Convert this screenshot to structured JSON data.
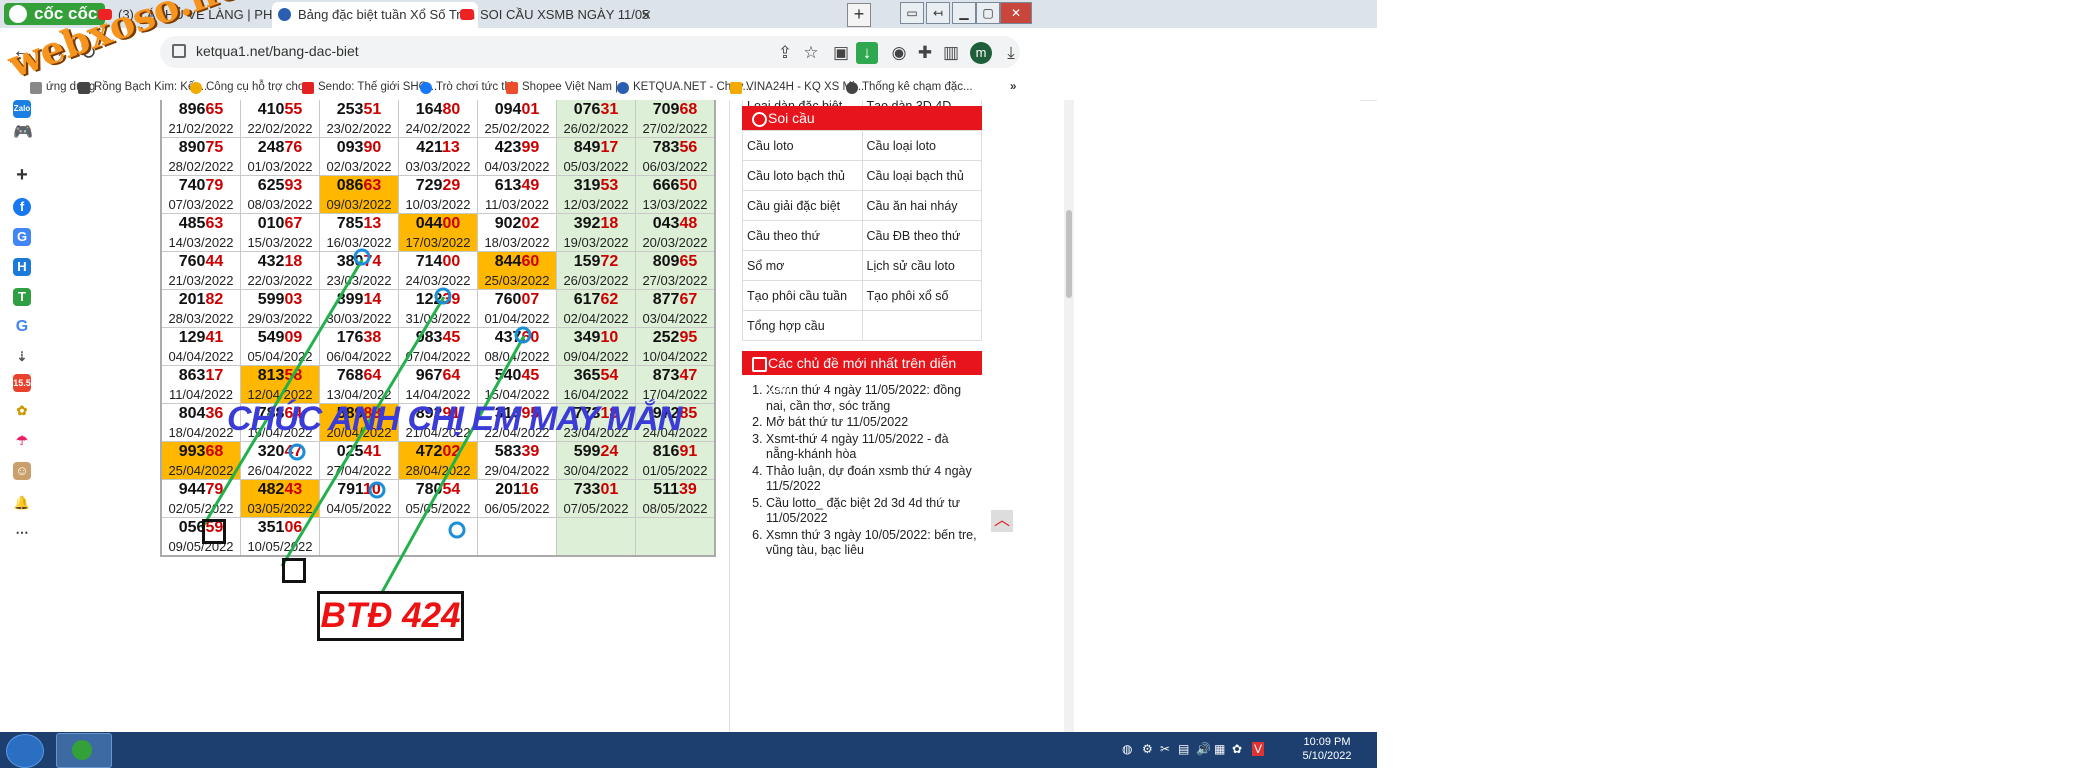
{
  "browser": {
    "brand": "cốc cốc",
    "tabs": [
      {
        "title": "(3) CÁCHỦ VỀ LÀNG | PHIM",
        "icon": "youtube-icon"
      },
      {
        "title": "Bảng đặc biệt tuần Xổ Số Trun",
        "icon": "ketqua-icon",
        "active": true
      },
      {
        "title": "SOI CẦU XSMB NGÀY 11/05",
        "icon": "youtube-icon"
      }
    ],
    "url": "ketqua1.net/bang-dac-biet",
    "profile_initial": "m",
    "bookmarks": [
      "ứng dụng",
      "Rồng Bạch Kim: Kết...",
      "Công cụ hỗ trợ cho...",
      "Sendo: Thế giới SHO...",
      "Trò chơi tức thì",
      "Shopee Việt Nam |...",
      "KETQUA.NET - Chuy...",
      "VINA24H - KQ XS Mi...",
      "Thống kê chạm đặc..."
    ],
    "overflow": "»"
  },
  "watermark": "webxoso.net",
  "grid": {
    "rows": [
      [
        {
          "n": "89665",
          "d": "21/02/2022"
        },
        {
          "n": "41055",
          "d": "22/02/2022"
        },
        {
          "n": "25351",
          "d": "23/02/2022"
        },
        {
          "n": "16480",
          "d": "24/02/2022"
        },
        {
          "n": "09401",
          "d": "25/02/2022"
        },
        {
          "n": "07631",
          "d": "26/02/2022"
        },
        {
          "n": "70968",
          "d": "27/02/2022"
        }
      ],
      [
        {
          "n": "89075",
          "d": "28/02/2022"
        },
        {
          "n": "24876",
          "d": "01/03/2022"
        },
        {
          "n": "09390",
          "d": "02/03/2022"
        },
        {
          "n": "42113",
          "d": "03/03/2022"
        },
        {
          "n": "42399",
          "d": "04/03/2022"
        },
        {
          "n": "84917",
          "d": "05/03/2022"
        },
        {
          "n": "78356",
          "d": "06/03/2022"
        }
      ],
      [
        {
          "n": "74079",
          "d": "07/03/2022"
        },
        {
          "n": "62593",
          "d": "08/03/2022"
        },
        {
          "n": "08663",
          "d": "09/03/2022",
          "hl": true
        },
        {
          "n": "72929",
          "d": "10/03/2022"
        },
        {
          "n": "61349",
          "d": "11/03/2022"
        },
        {
          "n": "31953",
          "d": "12/03/2022"
        },
        {
          "n": "66650",
          "d": "13/03/2022"
        }
      ],
      [
        {
          "n": "48563",
          "d": "14/03/2022"
        },
        {
          "n": "01067",
          "d": "15/03/2022"
        },
        {
          "n": "78513",
          "d": "16/03/2022"
        },
        {
          "n": "04400",
          "d": "17/03/2022",
          "hl": true
        },
        {
          "n": "90202",
          "d": "18/03/2022"
        },
        {
          "n": "39218",
          "d": "19/03/2022"
        },
        {
          "n": "04348",
          "d": "20/03/2022"
        }
      ],
      [
        {
          "n": "76044",
          "d": "21/03/2022"
        },
        {
          "n": "43218",
          "d": "22/03/2022"
        },
        {
          "n": "38074",
          "d": "23/03/2022"
        },
        {
          "n": "71400",
          "d": "24/03/2022"
        },
        {
          "n": "84460",
          "d": "25/03/2022",
          "hl": true
        },
        {
          "n": "15972",
          "d": "26/03/2022"
        },
        {
          "n": "80965",
          "d": "27/03/2022"
        }
      ],
      [
        {
          "n": "20182",
          "d": "28/03/2022"
        },
        {
          "n": "59903",
          "d": "29/03/2022"
        },
        {
          "n": "89914",
          "d": "30/03/2022"
        },
        {
          "n": "12239",
          "d": "31/03/2022"
        },
        {
          "n": "76007",
          "d": "01/04/2022"
        },
        {
          "n": "61762",
          "d": "02/04/2022"
        },
        {
          "n": "87767",
          "d": "03/04/2022"
        }
      ],
      [
        {
          "n": "12941",
          "d": "04/04/2022"
        },
        {
          "n": "54909",
          "d": "05/04/2022"
        },
        {
          "n": "17638",
          "d": "06/04/2022"
        },
        {
          "n": "98345",
          "d": "07/04/2022"
        },
        {
          "n": "43760",
          "d": "08/04/2022"
        },
        {
          "n": "34910",
          "d": "09/04/2022"
        },
        {
          "n": "25295",
          "d": "10/04/2022"
        }
      ],
      [
        {
          "n": "86317",
          "d": "11/04/2022"
        },
        {
          "n": "81358",
          "d": "12/04/2022",
          "hl": true
        },
        {
          "n": "76864",
          "d": "13/04/2022"
        },
        {
          "n": "96764",
          "d": "14/04/2022"
        },
        {
          "n": "54045",
          "d": "15/04/2022"
        },
        {
          "n": "36554",
          "d": "16/04/2022"
        },
        {
          "n": "87347",
          "d": "17/04/2022"
        }
      ],
      [
        {
          "n": "80436",
          "d": "18/04/2022"
        },
        {
          "n": "78864",
          "d": "19/04/2022"
        },
        {
          "n": "58983",
          "d": "20/04/2022",
          "hl": true
        },
        {
          "n": "89291",
          "d": "21/04/2022"
        },
        {
          "n": "31695",
          "d": "22/04/2022"
        },
        {
          "n": "77318",
          "d": "23/04/2022"
        },
        {
          "n": "97285",
          "d": "24/04/2022"
        }
      ],
      [
        {
          "n": "99368",
          "d": "25/04/2022",
          "hl": true
        },
        {
          "n": "32047",
          "d": "26/04/2022"
        },
        {
          "n": "02541",
          "d": "27/04/2022"
        },
        {
          "n": "47202",
          "d": "28/04/2022",
          "hl": true
        },
        {
          "n": "58339",
          "d": "29/04/2022"
        },
        {
          "n": "59924",
          "d": "30/04/2022"
        },
        {
          "n": "81691",
          "d": "01/05/2022"
        }
      ],
      [
        {
          "n": "94479",
          "d": "02/05/2022"
        },
        {
          "n": "48243",
          "d": "03/05/2022",
          "hl": true
        },
        {
          "n": "79110",
          "d": "04/05/2022"
        },
        {
          "n": "78054",
          "d": "05/05/2022"
        },
        {
          "n": "20116",
          "d": "06/05/2022"
        },
        {
          "n": "73301",
          "d": "07/05/2022"
        },
        {
          "n": "51139",
          "d": "08/05/2022"
        }
      ],
      [
        {
          "n": "05659",
          "d": "09/05/2022"
        },
        {
          "n": "35106",
          "d": "10/05/2022"
        },
        {
          "n": "",
          "d": ""
        },
        {
          "n": "",
          "d": ""
        },
        {
          "n": "",
          "d": ""
        },
        {
          "n": "",
          "d": ""
        },
        {
          "n": "",
          "d": ""
        }
      ]
    ]
  },
  "annotations": {
    "greeting": "CHÚC ANH CHỊ EM MAY MẮN",
    "prediction": "BTĐ 424"
  },
  "sidebar": {
    "top_links": [
      "Loại dàn đặc biệt",
      "Tạo dàn 3D 4D"
    ],
    "soi_cau_title": "Soi cầu",
    "soi_cau_links": [
      [
        "Cầu loto",
        "Cầu loại loto"
      ],
      [
        "Cầu loto bạch thủ",
        "Cầu loại bạch thủ"
      ],
      [
        "Cầu giải đặc biệt",
        "Cầu ăn hai nháy"
      ],
      [
        "Cầu theo thứ",
        "Cầu ĐB theo thứ"
      ],
      [
        "Sổ mơ",
        "Lịch sử cầu loto"
      ],
      [
        "Tạo phôi cầu tuần",
        "Tạo phôi xổ số"
      ],
      [
        "Tổng hợp cầu",
        ""
      ]
    ],
    "topics_title": "Các chủ đề mới nhất trên diễn đàn",
    "topics": [
      "Xsmn thứ 4 ngày 11/05/2022: đồng nai, cần thơ, sóc trăng",
      "Mở bát thứ tư 11/05/2022",
      "Xsmt-thứ 4 ngày 11/05/2022 - đà nẵng-khánh hòa",
      "Thảo luận, dự đoán xsmb thứ 4 ngày 11/5/2022",
      "Cầu lotto_ đặc biệt 2d 3d 4d thứ tư 11/05/2022",
      "Xsmn thứ 3 ngày 10/05/2022: bến tre, vũng tàu, bạc liêu"
    ]
  },
  "taskbar": {
    "time": "10:09 PM",
    "date": "5/10/2022"
  },
  "colors": {
    "highlight": "#ffb700",
    "weekend": "#ddefd6",
    "accent_red": "#e8141c",
    "line_green": "#22b14c",
    "circle_blue": "#1a8fd8"
  }
}
